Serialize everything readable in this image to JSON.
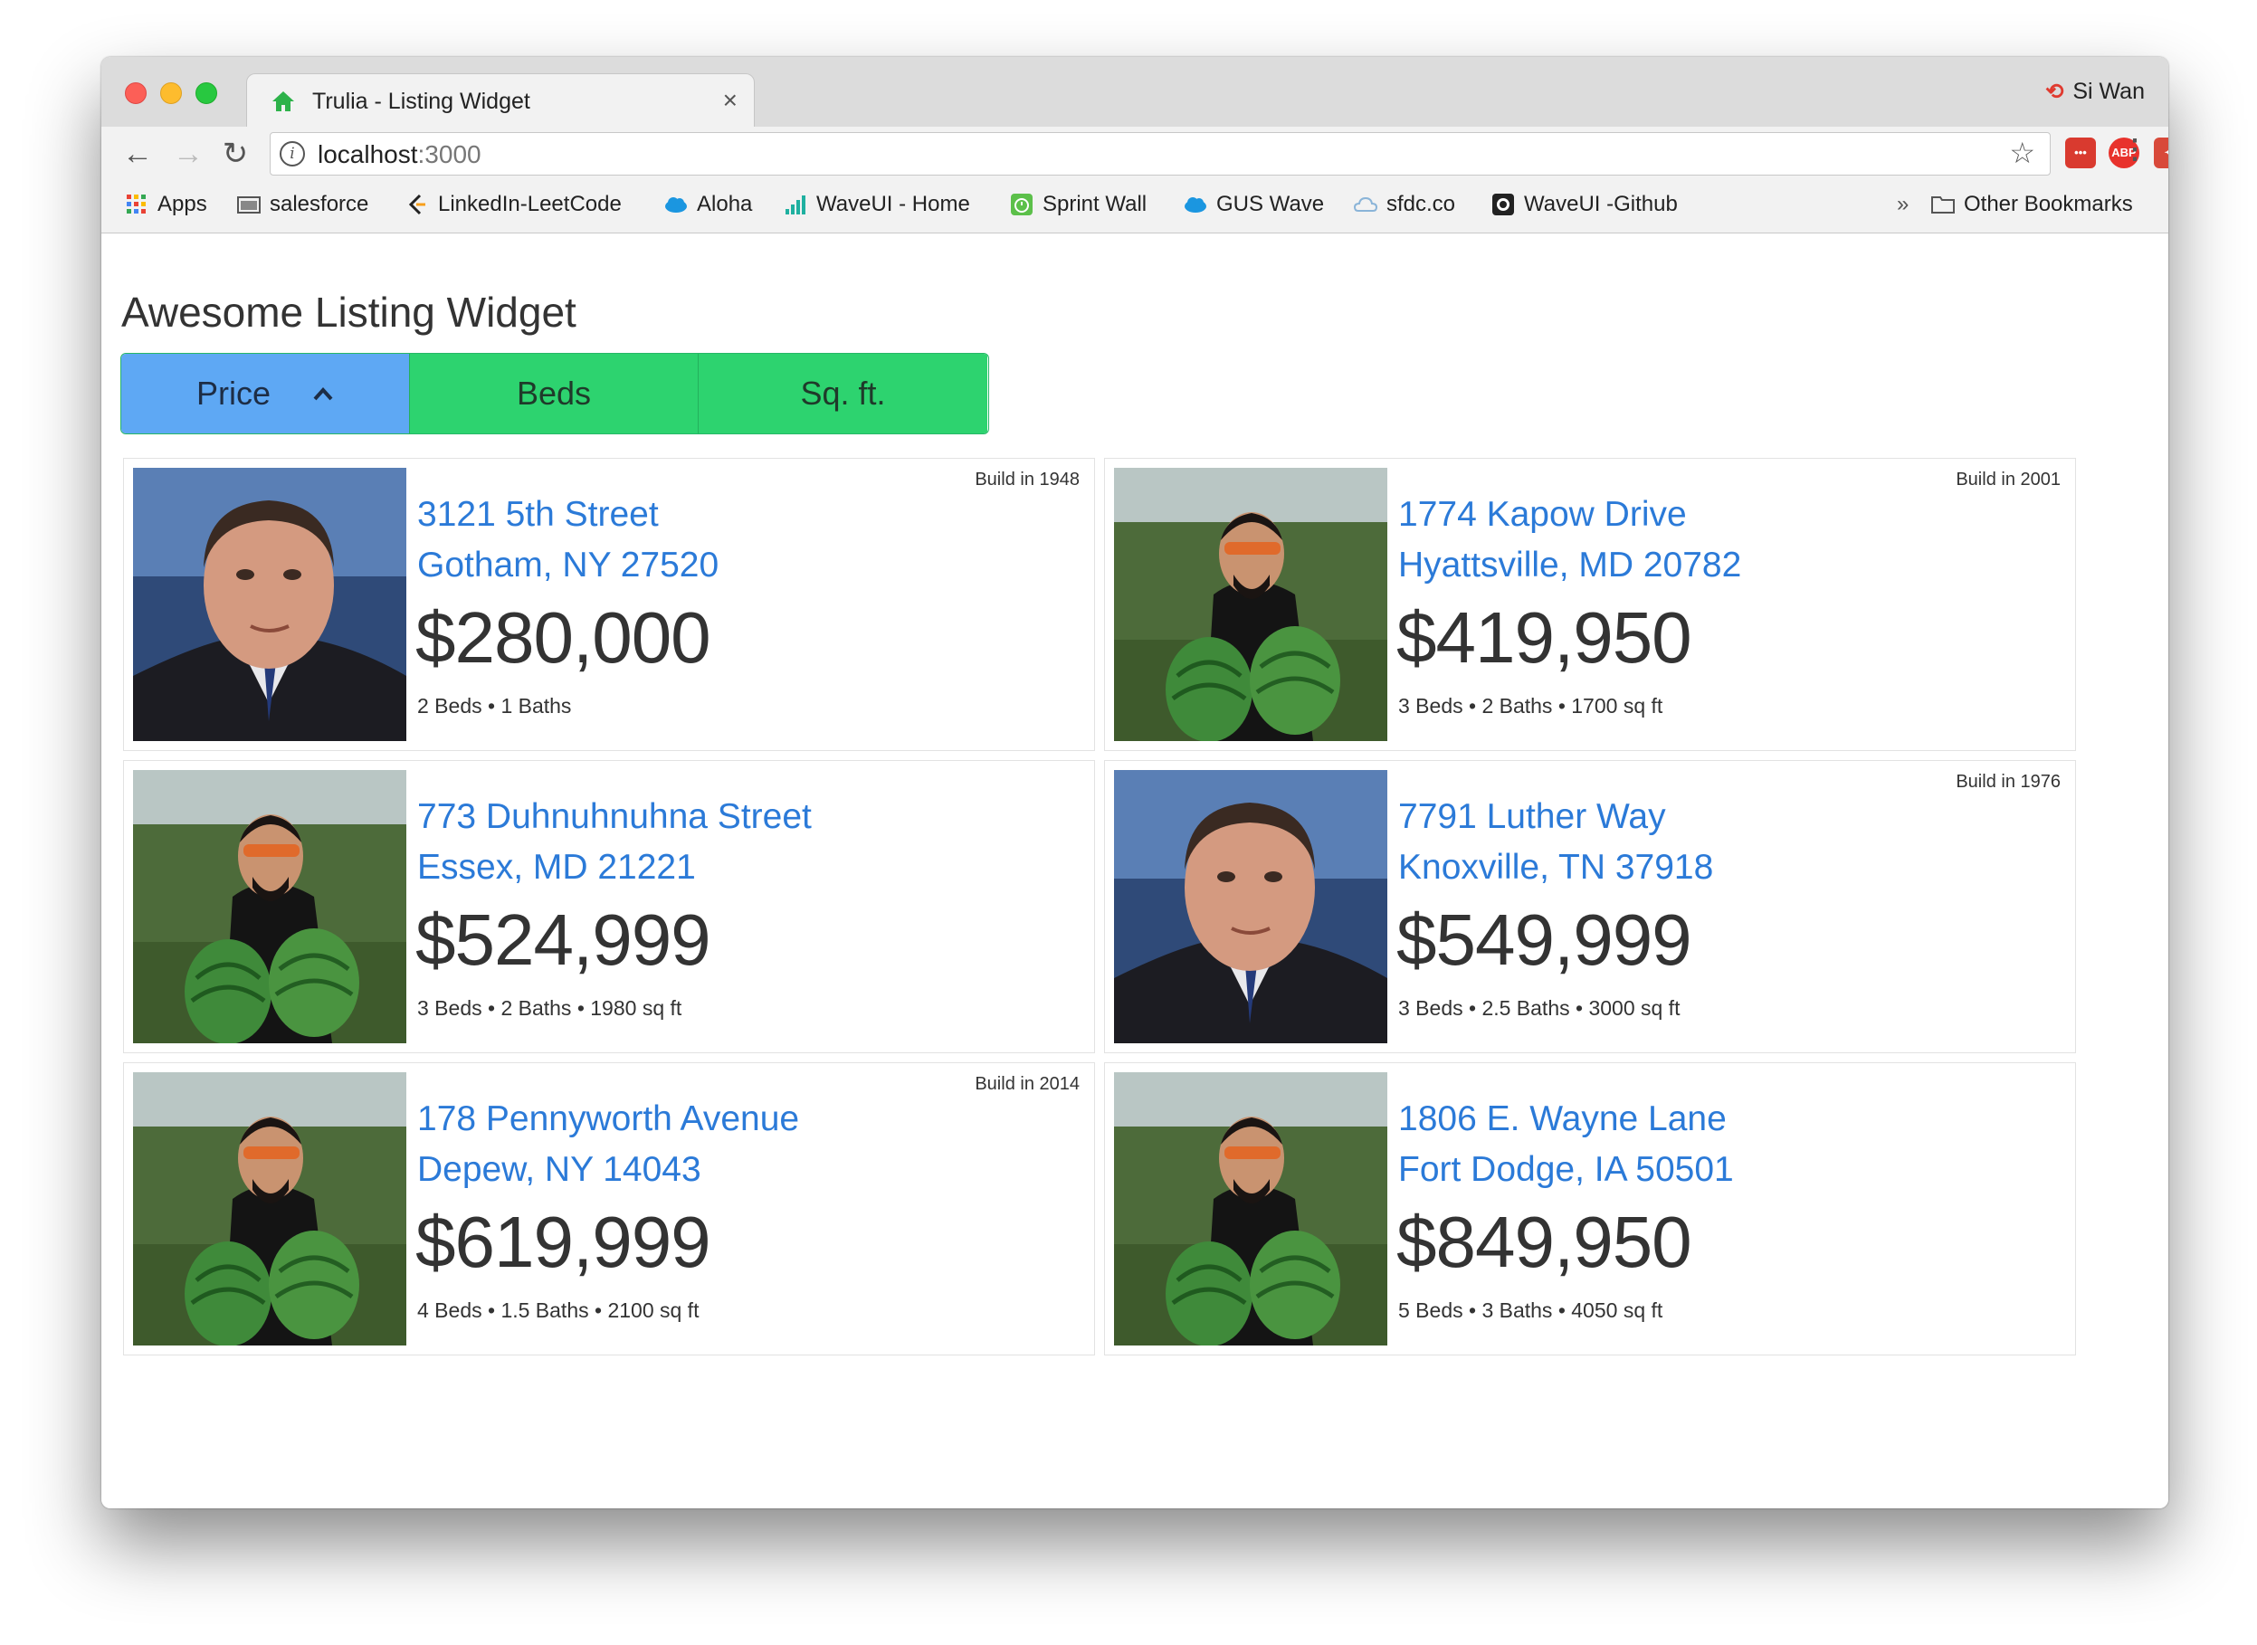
{
  "browser": {
    "tab_title": "Trulia - Listing Widget",
    "tab_close": "×",
    "profile_name": "Si Wan",
    "url_host": "localhost",
    "url_port": ":3000",
    "ext_abp": "ABP",
    "bookmarks": [
      {
        "label": "Apps",
        "icon": "apps-grid-icon"
      },
      {
        "label": "salesforce",
        "icon": "folder-icon"
      },
      {
        "label": "LinkedIn-LeetCode",
        "icon": "leetcode-icon"
      },
      {
        "label": "Aloha",
        "icon": "cloud-icon"
      },
      {
        "label": "WaveUI - Home",
        "icon": "bar-chart-icon"
      },
      {
        "label": "Sprint Wall",
        "icon": "timer-icon"
      },
      {
        "label": "GUS Wave",
        "icon": "cloud-icon"
      },
      {
        "label": "sfdc.co",
        "icon": "cloud-outline-icon"
      },
      {
        "label": "WaveUI -Github",
        "icon": "github-icon"
      }
    ],
    "overflow": "»",
    "other_bookmarks": "Other Bookmarks"
  },
  "widget": {
    "title": "Awesome Listing Widget",
    "sort_buttons": [
      {
        "label": "Price",
        "active": true
      },
      {
        "label": "Beds",
        "active": false
      },
      {
        "label": "Sq. ft.",
        "active": false
      }
    ]
  },
  "listings": [
    {
      "street": "3121 5th Street",
      "city": "Gotham, NY 27520",
      "price": "$280,000",
      "details": "2 Beds • 1 Baths",
      "build": "Build in 1948",
      "photo": "man-in-suit-photo"
    },
    {
      "street": "1774 Kapow Drive",
      "city": "Hyattsville, MD 20782",
      "price": "$419,950",
      "details": "3 Beds • 2 Baths • 1700 sq ft",
      "build": "Build in 2001",
      "photo": "man-with-watermelons-photo"
    },
    {
      "street": "773 Duhnuhnuhna Street",
      "city": "Essex, MD 21221",
      "price": "$524,999",
      "details": "3 Beds • 2 Baths • 1980 sq ft",
      "build": "",
      "photo": "man-with-watermelons-photo"
    },
    {
      "street": "7791 Luther Way",
      "city": "Knoxville, TN 37918",
      "price": "$549,999",
      "details": "3 Beds • 2.5 Baths • 3000 sq ft",
      "build": "Build in 1976",
      "photo": "man-in-suit-photo"
    },
    {
      "street": "178 Pennyworth Avenue",
      "city": "Depew, NY 14043",
      "price": "$619,999",
      "details": "4 Beds • 1.5 Baths • 2100 sq ft",
      "build": "Build in 2014",
      "photo": "man-with-watermelons-photo"
    },
    {
      "street": "1806 E. Wayne Lane",
      "city": "Fort Dodge, IA 50501",
      "price": "$849,950",
      "details": "5 Beds • 3 Baths • 4050 sq ft",
      "build": "",
      "photo": "man-with-watermelons-photo"
    }
  ]
}
